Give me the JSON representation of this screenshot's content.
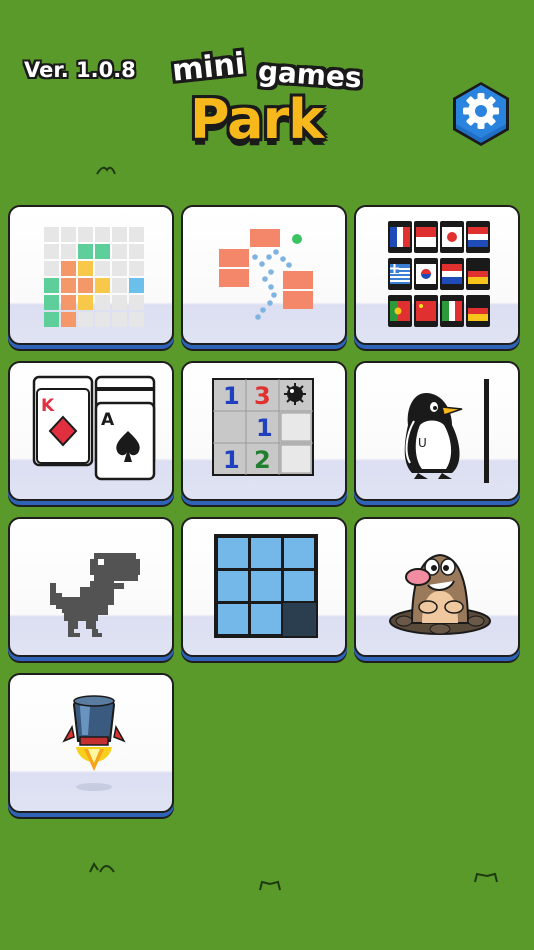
{
  "header": {
    "version": "Ver. 1.0.8",
    "logo_line1": "mini",
    "logo_line2": "games",
    "logo_line3": "Park"
  },
  "settings_icon": "gear-icon",
  "games": [
    {
      "id": "block-puzzle",
      "icon": "block-puzzle-icon"
    },
    {
      "id": "brick-breaker",
      "icon": "brick-breaker-icon"
    },
    {
      "id": "flag-match",
      "icon": "flags-icon"
    },
    {
      "id": "solitaire",
      "icon": "playing-cards-icon",
      "card1": "K",
      "card2": "A"
    },
    {
      "id": "minesweeper",
      "icon": "minesweeper-icon",
      "cells": [
        "1",
        "3",
        "1",
        "1",
        "2"
      ]
    },
    {
      "id": "penguin",
      "icon": "penguin-icon"
    },
    {
      "id": "dino-runner",
      "icon": "dinosaur-icon"
    },
    {
      "id": "sliding-puzzle",
      "icon": "sliding-tiles-icon"
    },
    {
      "id": "whack-a-mole",
      "icon": "mole-icon"
    },
    {
      "id": "rocket",
      "icon": "rocket-icon"
    }
  ],
  "colors": {
    "background": "#5a9a2a",
    "tile_shadow": "#2e63b8",
    "settings": "#1f6fc4",
    "logo_park": "#f7b81c"
  }
}
